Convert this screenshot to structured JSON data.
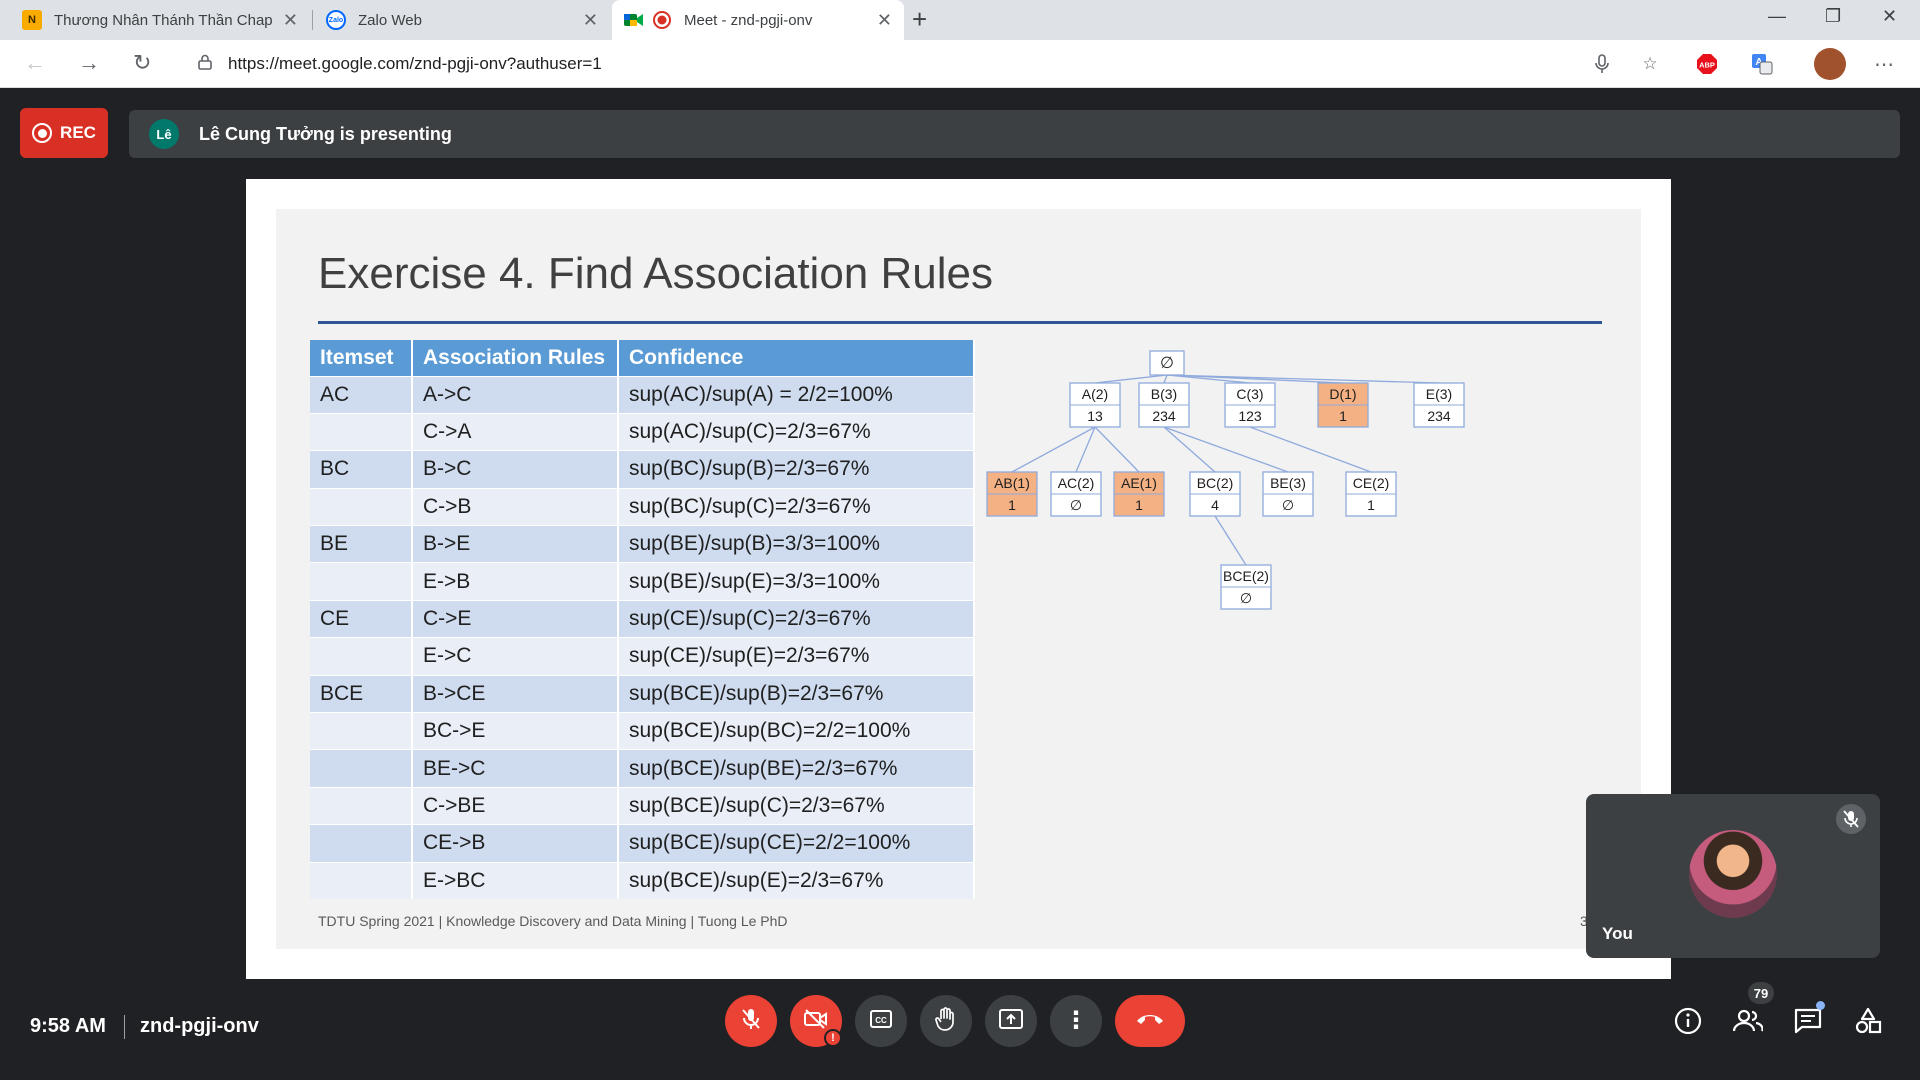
{
  "browser": {
    "tabs": [
      {
        "title": "Thương Nhân Thánh Thần Chap",
        "favicon": "N"
      },
      {
        "title": "Zalo Web",
        "favicon": "Zalo"
      },
      {
        "title": "Meet - znd-pgji-onv",
        "favicon": "meet"
      }
    ],
    "url": "https://meet.google.com/znd-pgji-onv?authuser=1"
  },
  "meet": {
    "rec_label": "REC",
    "presenter_avatar": "Lê",
    "presenting_text": "Lê Cung Tưởng is presenting",
    "self_label": "You",
    "time": "9:58 AM",
    "meeting_code": "znd-pgji-onv",
    "participant_count": "79"
  },
  "slide": {
    "title": "Exercise 4. Find Association Rules",
    "table_headers": [
      "Itemset",
      "Association Rules",
      "Confidence"
    ],
    "rows": [
      {
        "itemset": "AC",
        "rule": "A->C",
        "confidence": "sup(AC)/sup(A) = 2/2=100%"
      },
      {
        "itemset": "",
        "rule": "C->A",
        "confidence": "sup(AC)/sup(C)=2/3=67%"
      },
      {
        "itemset": "BC",
        "rule": "B->C",
        "confidence": "sup(BC)/sup(B)=2/3=67%"
      },
      {
        "itemset": "",
        "rule": "C->B",
        "confidence": "sup(BC)/sup(C)=2/3=67%"
      },
      {
        "itemset": "BE",
        "rule": "B->E",
        "confidence": "sup(BE)/sup(B)=3/3=100%"
      },
      {
        "itemset": "",
        "rule": "E->B",
        "confidence": "sup(BE)/sup(E)=3/3=100%"
      },
      {
        "itemset": "CE",
        "rule": "C->E",
        "confidence": "sup(CE)/sup(C)=2/3=67%"
      },
      {
        "itemset": "",
        "rule": "E->C",
        "confidence": "sup(CE)/sup(E)=2/3=67%"
      },
      {
        "itemset": "BCE",
        "rule": "B->CE",
        "confidence": "sup(BCE)/sup(B)=2/3=67%"
      },
      {
        "itemset": "",
        "rule": "BC->E",
        "confidence": "sup(BCE)/sup(BC)=2/2=100%"
      },
      {
        "itemset": "",
        "rule": "BE->C",
        "confidence": "sup(BCE)/sup(BE)=2/3=67%"
      },
      {
        "itemset": "",
        "rule": "C->BE",
        "confidence": "sup(BCE)/sup(C)=2/3=67%"
      },
      {
        "itemset": "",
        "rule": "CE->B",
        "confidence": "sup(BCE)/sup(CE)=2/2=100%"
      },
      {
        "itemset": "",
        "rule": "E->BC",
        "confidence": "sup(BCE)/sup(E)=2/3=67%"
      }
    ],
    "tree_nodes": [
      {
        "id": "root",
        "label": "∅",
        "tid": "",
        "pruned": false
      },
      {
        "id": "A",
        "label": "A(2)",
        "tid": "13",
        "pruned": false
      },
      {
        "id": "B",
        "label": "B(3)",
        "tid": "234",
        "pruned": false
      },
      {
        "id": "C",
        "label": "C(3)",
        "tid": "123",
        "pruned": false
      },
      {
        "id": "D",
        "label": "D(1)",
        "tid": "1",
        "pruned": true
      },
      {
        "id": "E",
        "label": "E(3)",
        "tid": "234",
        "pruned": false
      },
      {
        "id": "AB",
        "label": "AB(1)",
        "tid": "1",
        "pruned": true
      },
      {
        "id": "AC",
        "label": "AC(2)",
        "tid": "∅",
        "pruned": false
      },
      {
        "id": "AE",
        "label": "AE(1)",
        "tid": "1",
        "pruned": true
      },
      {
        "id": "BC",
        "label": "BC(2)",
        "tid": "4",
        "pruned": false
      },
      {
        "id": "BE",
        "label": "BE(3)",
        "tid": "∅",
        "pruned": false
      },
      {
        "id": "CE",
        "label": "CE(2)",
        "tid": "1",
        "pruned": false
      },
      {
        "id": "BCE",
        "label": "BCE(2)",
        "tid": "∅",
        "pruned": false
      }
    ],
    "tree_edges": [
      [
        "root",
        "A"
      ],
      [
        "root",
        "B"
      ],
      [
        "root",
        "C"
      ],
      [
        "root",
        "D"
      ],
      [
        "root",
        "E"
      ],
      [
        "A",
        "AB"
      ],
      [
        "A",
        "AC"
      ],
      [
        "A",
        "AE"
      ],
      [
        "B",
        "BC"
      ],
      [
        "B",
        "BE"
      ],
      [
        "C",
        "CE"
      ],
      [
        "BC",
        "BCE"
      ]
    ],
    "footer": "TDTU Spring 2021 | Knowledge Discovery and Data Mining | Tuong Le PhD",
    "page_number": "3",
    "colors": {
      "header": "#5b9bd5",
      "row_odd": "#cfdcef",
      "row_even": "#e9eef7",
      "pruned_node": "#f4b183",
      "node_border": "#8faadc",
      "title_rule": "#2f5597"
    }
  },
  "controls": [
    "mic-off",
    "camera-off",
    "captions",
    "raise-hand",
    "present-now",
    "more-options",
    "leave-call"
  ],
  "right_controls": [
    "meeting-details",
    "people",
    "chat",
    "activities"
  ]
}
